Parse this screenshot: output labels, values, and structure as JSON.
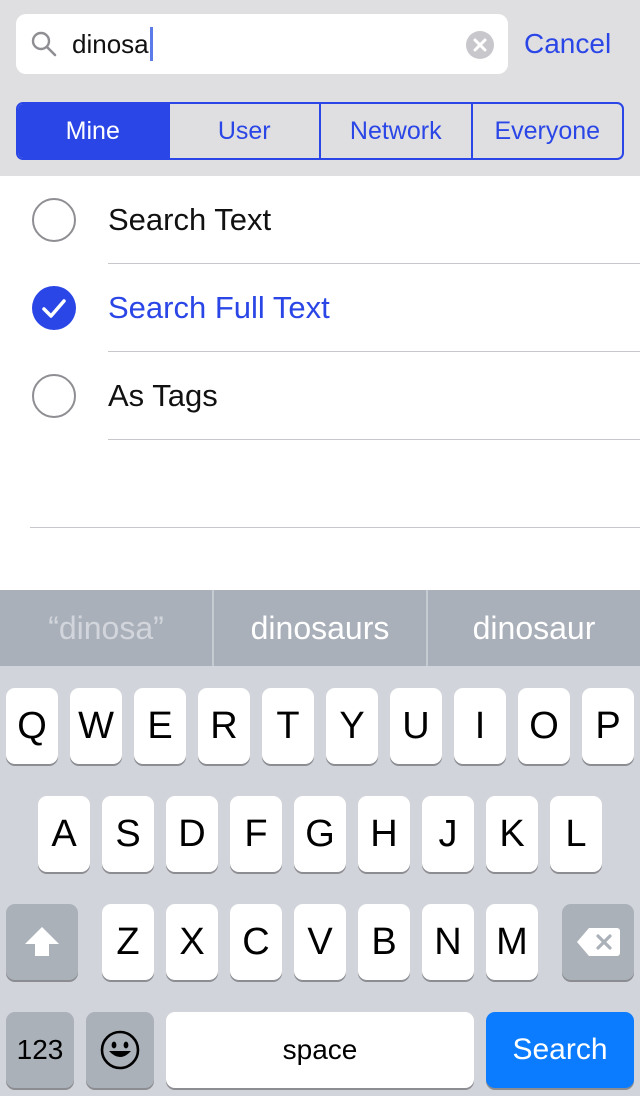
{
  "search": {
    "value": "dinosa",
    "cancel_label": "Cancel"
  },
  "scope_tabs": [
    {
      "label": "Mine",
      "active": true
    },
    {
      "label": "User",
      "active": false
    },
    {
      "label": "Network",
      "active": false
    },
    {
      "label": "Everyone",
      "active": false
    }
  ],
  "options": [
    {
      "label": "Search Text",
      "checked": false
    },
    {
      "label": "Search Full Text",
      "checked": true
    },
    {
      "label": "As Tags",
      "checked": false
    }
  ],
  "predictions": [
    "“dinosa”",
    "dinosaurs",
    "dinosaur"
  ],
  "keyboard": {
    "row1": [
      "Q",
      "W",
      "E",
      "R",
      "T",
      "Y",
      "U",
      "I",
      "O",
      "P"
    ],
    "row2": [
      "A",
      "S",
      "D",
      "F",
      "G",
      "H",
      "J",
      "K",
      "L"
    ],
    "row3": [
      "Z",
      "X",
      "C",
      "V",
      "B",
      "N",
      "M"
    ],
    "numbers_label": "123",
    "space_label": "space",
    "search_label": "Search"
  },
  "colors": {
    "accent": "#2a46e6",
    "keyboard_bg": "#d1d4da",
    "search_key": "#0b7cff"
  },
  "icons": [
    "search-icon",
    "clear-icon",
    "checkmark-icon",
    "shift-icon",
    "delete-icon",
    "emoji-icon"
  ]
}
